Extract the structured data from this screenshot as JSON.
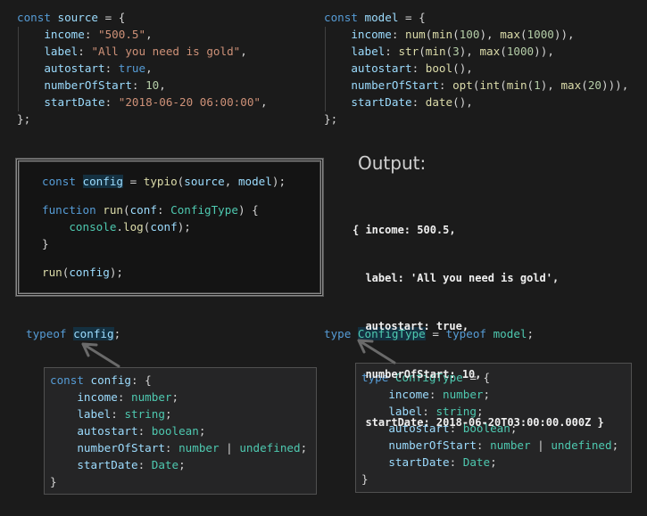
{
  "colors": {
    "background": "#1b1b1b",
    "keyword": "#569cd6",
    "variable": "#9cdcfe",
    "string": "#ce9178",
    "function": "#dcdcaa",
    "type": "#4ec9b0",
    "number": "#b5cea8"
  },
  "blocks": {
    "source": {
      "lines": [
        [
          [
            "const ",
            "k"
          ],
          [
            "source",
            "v"
          ],
          [
            " = {",
            "p"
          ]
        ],
        [
          [
            "    ",
            "p"
          ],
          [
            "income",
            "v"
          ],
          [
            ": ",
            "p"
          ],
          [
            "\"500.5\"",
            "s"
          ],
          [
            ",",
            "p"
          ]
        ],
        [
          [
            "    ",
            "p"
          ],
          [
            "label",
            "v"
          ],
          [
            ": ",
            "p"
          ],
          [
            "\"All you need is gold\"",
            "s"
          ],
          [
            ",",
            "p"
          ]
        ],
        [
          [
            "    ",
            "p"
          ],
          [
            "autostart",
            "v"
          ],
          [
            ": ",
            "p"
          ],
          [
            "true",
            "k"
          ],
          [
            ",",
            "p"
          ]
        ],
        [
          [
            "    ",
            "p"
          ],
          [
            "numberOfStart",
            "v"
          ],
          [
            ": ",
            "p"
          ],
          [
            "10",
            "n"
          ],
          [
            ",",
            "p"
          ]
        ],
        [
          [
            "    ",
            "p"
          ],
          [
            "startDate",
            "v"
          ],
          [
            ": ",
            "p"
          ],
          [
            "\"2018-06-20 06:00:00\"",
            "s"
          ],
          [
            ",",
            "p"
          ]
        ],
        [
          [
            "};",
            "p"
          ]
        ]
      ]
    },
    "model": {
      "lines": [
        [
          [
            "const ",
            "k"
          ],
          [
            "model",
            "v"
          ],
          [
            " = {",
            "p"
          ]
        ],
        [
          [
            "    ",
            "p"
          ],
          [
            "income",
            "v"
          ],
          [
            ": ",
            "p"
          ],
          [
            "num",
            "f"
          ],
          [
            "(",
            "p"
          ],
          [
            "min",
            "f"
          ],
          [
            "(",
            "p"
          ],
          [
            "100",
            "n"
          ],
          [
            "), ",
            "p"
          ],
          [
            "max",
            "f"
          ],
          [
            "(",
            "p"
          ],
          [
            "1000",
            "n"
          ],
          [
            ")),",
            "p"
          ]
        ],
        [
          [
            "    ",
            "p"
          ],
          [
            "label",
            "v"
          ],
          [
            ": ",
            "p"
          ],
          [
            "str",
            "f"
          ],
          [
            "(",
            "p"
          ],
          [
            "min",
            "f"
          ],
          [
            "(",
            "p"
          ],
          [
            "3",
            "n"
          ],
          [
            "), ",
            "p"
          ],
          [
            "max",
            "f"
          ],
          [
            "(",
            "p"
          ],
          [
            "1000",
            "n"
          ],
          [
            ")),",
            "p"
          ]
        ],
        [
          [
            "    ",
            "p"
          ],
          [
            "autostart",
            "v"
          ],
          [
            ": ",
            "p"
          ],
          [
            "bool",
            "f"
          ],
          [
            "(),",
            "p"
          ]
        ],
        [
          [
            "    ",
            "p"
          ],
          [
            "numberOfStart",
            "v"
          ],
          [
            ": ",
            "p"
          ],
          [
            "opt",
            "f"
          ],
          [
            "(",
            "p"
          ],
          [
            "int",
            "f"
          ],
          [
            "(",
            "p"
          ],
          [
            "min",
            "f"
          ],
          [
            "(",
            "p"
          ],
          [
            "1",
            "n"
          ],
          [
            "), ",
            "p"
          ],
          [
            "max",
            "f"
          ],
          [
            "(",
            "p"
          ],
          [
            "20",
            "n"
          ],
          [
            "))),",
            "p"
          ]
        ],
        [
          [
            "    ",
            "p"
          ],
          [
            "startDate",
            "v"
          ],
          [
            ": ",
            "p"
          ],
          [
            "date",
            "f"
          ],
          [
            "(),",
            "p"
          ]
        ],
        [
          [
            "};",
            "p"
          ]
        ]
      ]
    },
    "main": {
      "lines": [
        [
          [
            "const ",
            "k"
          ],
          [
            "config",
            "h"
          ],
          [
            " = ",
            "p"
          ],
          [
            "typio",
            "f"
          ],
          [
            "(",
            "p"
          ],
          [
            "source",
            "v"
          ],
          [
            ", ",
            "p"
          ],
          [
            "model",
            "v"
          ],
          [
            ");",
            "p"
          ]
        ],
        [
          [
            "",
            "p"
          ]
        ],
        [
          [
            "function ",
            "k"
          ],
          [
            "run",
            "f"
          ],
          [
            "(",
            "p"
          ],
          [
            "conf",
            "v"
          ],
          [
            ": ",
            "p"
          ],
          [
            "ConfigType",
            "t"
          ],
          [
            ") {",
            "p"
          ]
        ],
        [
          [
            "    ",
            "p"
          ],
          [
            "console",
            "t"
          ],
          [
            ".",
            "p"
          ],
          [
            "log",
            "f"
          ],
          [
            "(",
            "p"
          ],
          [
            "conf",
            "v"
          ],
          [
            ");",
            "p"
          ]
        ],
        [
          [
            "}",
            "p"
          ]
        ],
        [
          [
            "",
            "p"
          ]
        ],
        [
          [
            "run",
            "f"
          ],
          [
            "(",
            "p"
          ],
          [
            "config",
            "v"
          ],
          [
            ");",
            "p"
          ]
        ]
      ]
    },
    "typeof_config": {
      "lines": [
        [
          [
            "typeof ",
            "k"
          ],
          [
            "config",
            "h"
          ],
          [
            ";",
            "p"
          ]
        ]
      ]
    },
    "type_decl": {
      "lines": [
        [
          [
            "type ",
            "k"
          ],
          [
            "ConfigType",
            "ht"
          ],
          [
            " = ",
            "p"
          ],
          [
            "typeof ",
            "k"
          ],
          [
            "model",
            "t"
          ],
          [
            ";",
            "p"
          ]
        ]
      ]
    },
    "pop_left": {
      "lines": [
        [
          [
            "const ",
            "k"
          ],
          [
            "config",
            "v"
          ],
          [
            ": {",
            "p"
          ]
        ],
        [
          [
            "    ",
            "p"
          ],
          [
            "income",
            "v"
          ],
          [
            ": ",
            "p"
          ],
          [
            "number",
            "t"
          ],
          [
            ";",
            "p"
          ]
        ],
        [
          [
            "    ",
            "p"
          ],
          [
            "label",
            "v"
          ],
          [
            ": ",
            "p"
          ],
          [
            "string",
            "t"
          ],
          [
            ";",
            "p"
          ]
        ],
        [
          [
            "    ",
            "p"
          ],
          [
            "autostart",
            "v"
          ],
          [
            ": ",
            "p"
          ],
          [
            "boolean",
            "t"
          ],
          [
            ";",
            "p"
          ]
        ],
        [
          [
            "    ",
            "p"
          ],
          [
            "numberOfStart",
            "v"
          ],
          [
            ": ",
            "p"
          ],
          [
            "number",
            "t"
          ],
          [
            " | ",
            "p"
          ],
          [
            "undefined",
            "t"
          ],
          [
            ";",
            "p"
          ]
        ],
        [
          [
            "    ",
            "p"
          ],
          [
            "startDate",
            "v"
          ],
          [
            ": ",
            "p"
          ],
          [
            "Date",
            "t"
          ],
          [
            ";",
            "p"
          ]
        ],
        [
          [
            "}",
            "p"
          ]
        ]
      ]
    },
    "pop_right": {
      "lines": [
        [
          [
            "type ",
            "k"
          ],
          [
            "ConfigType",
            "t"
          ],
          [
            " = {",
            "p"
          ]
        ],
        [
          [
            "    ",
            "p"
          ],
          [
            "income",
            "v"
          ],
          [
            ": ",
            "p"
          ],
          [
            "number",
            "t"
          ],
          [
            ";",
            "p"
          ]
        ],
        [
          [
            "    ",
            "p"
          ],
          [
            "label",
            "v"
          ],
          [
            ": ",
            "p"
          ],
          [
            "string",
            "t"
          ],
          [
            ";",
            "p"
          ]
        ],
        [
          [
            "    ",
            "p"
          ],
          [
            "autostart",
            "v"
          ],
          [
            ": ",
            "p"
          ],
          [
            "boolean",
            "t"
          ],
          [
            ";",
            "p"
          ]
        ],
        [
          [
            "    ",
            "p"
          ],
          [
            "numberOfStart",
            "v"
          ],
          [
            ": ",
            "p"
          ],
          [
            "number",
            "t"
          ],
          [
            " | ",
            "p"
          ],
          [
            "undefined",
            "t"
          ],
          [
            ";",
            "p"
          ]
        ],
        [
          [
            "    ",
            "p"
          ],
          [
            "startDate",
            "v"
          ],
          [
            ": ",
            "p"
          ],
          [
            "Date",
            "t"
          ],
          [
            ";",
            "p"
          ]
        ],
        [
          [
            "}",
            "p"
          ]
        ]
      ]
    }
  },
  "output": {
    "title": "Output:",
    "lines": [
      "{ income: 500.5,",
      "  label: 'All you need is gold',",
      "  autostart: true,",
      "  numberOfStart: 10,",
      "  startDate: 2018-06-20T03:00:00.000Z }"
    ]
  }
}
